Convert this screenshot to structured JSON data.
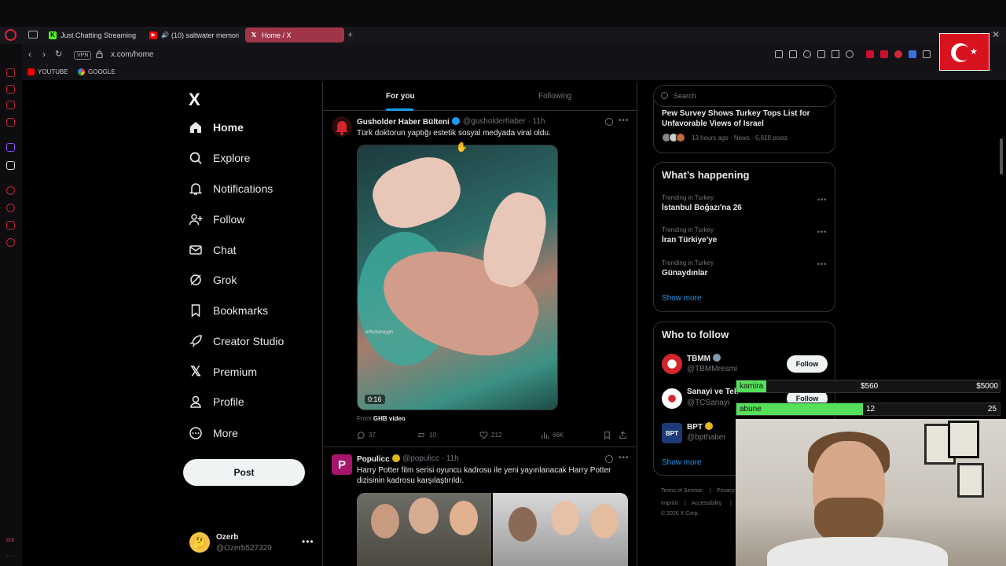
{
  "browser": {
    "tabs": [
      {
        "label": "Just Chatting Streaming -",
        "fav_color": "#53fc18"
      },
      {
        "label": "(10) saltwater memori",
        "fav_color": "#ff0000"
      },
      {
        "label": "Home / X",
        "fav_color": "#ffffff"
      }
    ],
    "new_tab": "+",
    "vpn_label": "VPN",
    "url": "x.com/home",
    "bookmarks": [
      "YOUTUBE",
      "GOOGLE"
    ],
    "accent": "#a0354a"
  },
  "nav": {
    "logo": "X",
    "items": [
      "Home",
      "Explore",
      "Notifications",
      "Follow",
      "Chat",
      "Grok",
      "Bookmarks",
      "Creator Studio",
      "Premium",
      "Profile",
      "More"
    ],
    "post_label": "Post",
    "user": {
      "name": "Ozerb",
      "handle": "@Ozerb527329",
      "avatar": "🤔"
    }
  },
  "feed": {
    "tabs": [
      "For you",
      "Following"
    ],
    "tweets": [
      {
        "name": "Gusholder Haber Bülteni",
        "handle": "@gusholderhaber",
        "time": "· 11h",
        "text": "Türk doktorun yaptığı estetik sosyal medyada viral oldu.",
        "video_duration": "0:16",
        "watermark": "drfurkanaygn",
        "from_prefix": "From",
        "from_source": "GHB video",
        "replies": "37",
        "reposts": "10",
        "likes": "212",
        "views": "66K"
      },
      {
        "name": "Populicc",
        "handle": "@populicc",
        "time": "· 11h",
        "text": "Harry Potter film serisi oyuncu kadrosu ile yeni yayınlanacak Harry Potter dizisinin kadrosu karşılaştırıldı."
      }
    ]
  },
  "sidebar": {
    "search_placeholder": "Search",
    "news": {
      "title": "Pew Survey Shows Turkey Tops List for Unfavorable Views of Israel",
      "meta": "13 hours ago · News · 6,618 posts"
    },
    "happening": {
      "title": "What’s happening",
      "trends": [
        {
          "category": "Trending in Turkey",
          "name": "İstanbul Boğazı'na 26"
        },
        {
          "category": "Trending in Turkey",
          "name": "İran Türkiye'ye"
        },
        {
          "category": "Trending in Turkey",
          "name": "Günaydınlar"
        }
      ],
      "show_more": "Show more"
    },
    "who_to_follow": {
      "title": "Who to follow",
      "accounts": [
        {
          "name": "TBMM",
          "handle": "@TBMMresmi",
          "follow": "Follow"
        },
        {
          "name": "Sanayi ve Tek",
          "handle": "@TCSanayi",
          "follow": "Follow"
        },
        {
          "name": "BPT",
          "handle": "@bpthaber",
          "avatar_text": "BPT"
        }
      ],
      "show_more": "Show more"
    },
    "footer": [
      "Terms of Service",
      "|",
      "Privacy",
      "Imprint",
      "|",
      "Accessibility",
      "|",
      "© 2026 X Corp."
    ]
  },
  "overlay": {
    "goals": [
      {
        "label": "kamira",
        "current": "$560",
        "target": "$5000",
        "progress": 0.112
      },
      {
        "label": "abune",
        "current": "12",
        "target": "25",
        "progress": 0.48
      }
    ],
    "goal_color": "#55e05a"
  }
}
